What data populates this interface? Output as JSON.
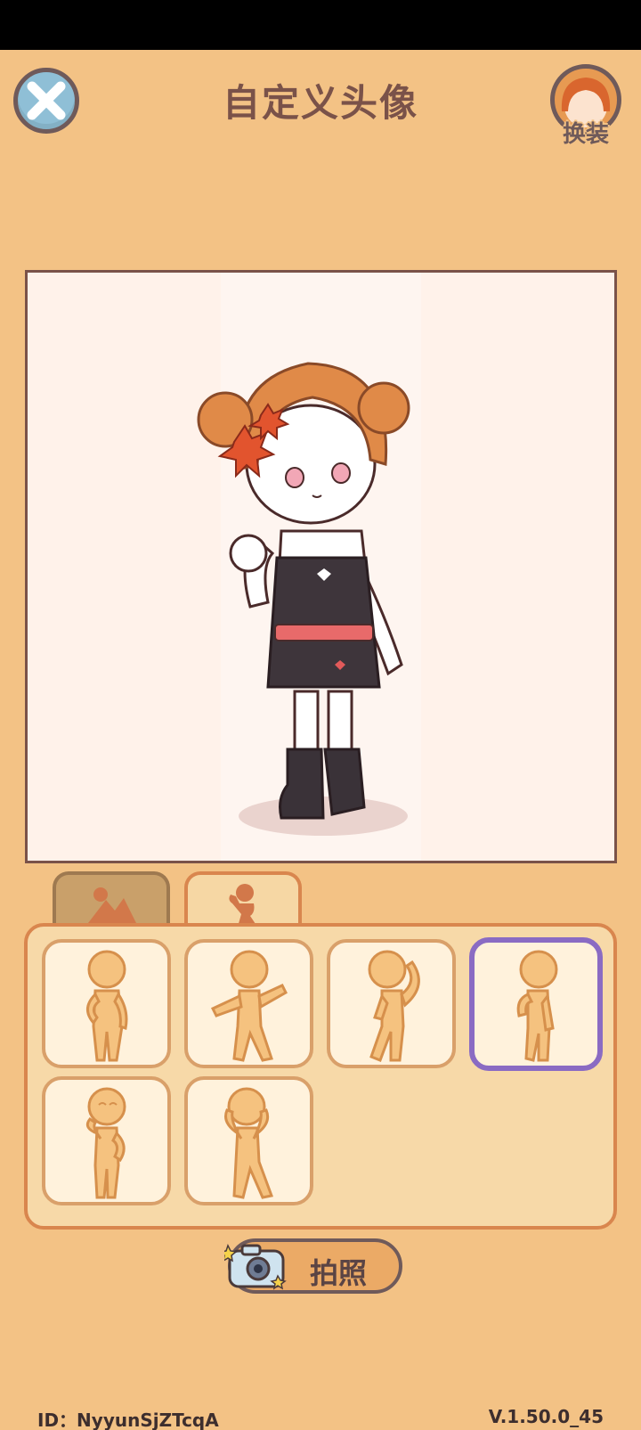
{
  "header": {
    "title": "自定义头像",
    "dress_label": "换装"
  },
  "tabs": [
    {
      "name": "background",
      "icon": "landscape-icon",
      "active": false
    },
    {
      "name": "pose",
      "icon": "pose-icon",
      "active": true
    }
  ],
  "poses": [
    {
      "icon": "pose-hand-on-hip-icon",
      "selected": false
    },
    {
      "icon": "pose-arms-out-icon",
      "selected": false
    },
    {
      "icon": "pose-salute-icon",
      "selected": false
    },
    {
      "icon": "pose-wave-icon",
      "selected": true
    },
    {
      "icon": "pose-thinking-icon",
      "selected": false
    },
    {
      "icon": "pose-peace-icon",
      "selected": false
    }
  ],
  "actions": {
    "photo_label": "拍照"
  },
  "footer": {
    "id_text": "ID：NyyunSjZTcqA",
    "version": "V.1.50.0_45"
  },
  "colors": {
    "background": "#F3C285",
    "accent_border": "#D9864E",
    "selected_border": "#8A6BC3"
  }
}
